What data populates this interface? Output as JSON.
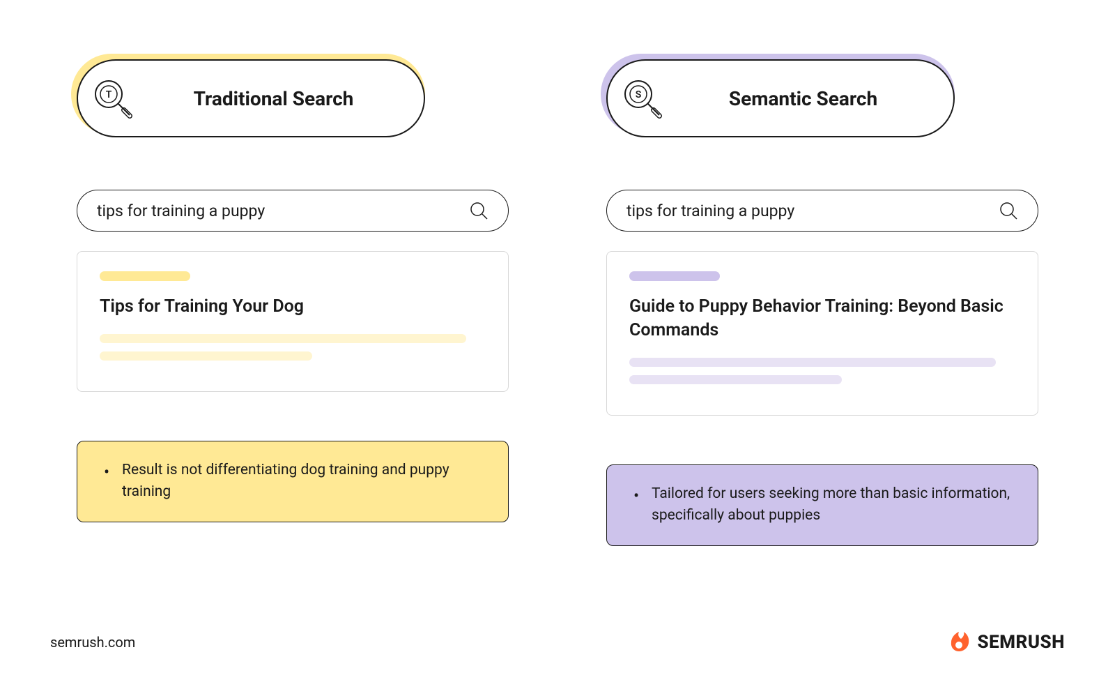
{
  "left": {
    "header_letter": "T",
    "header_title": "Traditional Search",
    "search_query": "tips for training a puppy",
    "result_title": "Tips for Training Your Dog",
    "callout": "Result is not differentiating dog training and puppy training",
    "accent_color": "#FFE995",
    "accent_light": "#FFF5D0"
  },
  "right": {
    "header_letter": "S",
    "header_title": "Semantic Search",
    "search_query": "tips for training a puppy",
    "result_title": "Guide to Puppy Behavior Training: Beyond Basic Commands",
    "callout": "Tailored for users seeking more than basic information, specifically about puppies",
    "accent_color": "#CDC3EB",
    "accent_light": "#E8E2F4"
  },
  "footer": {
    "url": "semrush.com",
    "brand": "SEMRUSH"
  }
}
